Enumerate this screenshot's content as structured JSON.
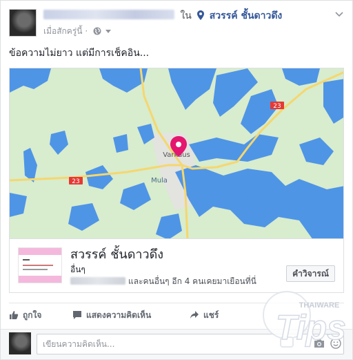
{
  "post": {
    "in_word": "ใน",
    "place_name": "สวรรค์ ชั้นดาวดึง",
    "timestamp": "เมื่อสักครู่นี้",
    "separator": "·",
    "text": "ข้อความไม่ยาว แต่มีการเช็คอิน..."
  },
  "map": {
    "city_label": "Varkaus",
    "town_label": "Mula",
    "road_label_west": "23",
    "road_label_east": "23"
  },
  "place_card": {
    "title": "สวรรค์ ชั้นดาวดึง",
    "category": "อื่นๆ",
    "visitors_text": "และคนอื่นๆ อีก 4 คนเคยมาเยือนที่นี่",
    "review_button": "คำวิจารณ์"
  },
  "actions": {
    "like": "ถูกใจ",
    "comment": "แสดงความคิดเห็น",
    "share": "แชร์"
  },
  "comment_box": {
    "placeholder": "เขียนความคิดเห็น..."
  },
  "watermark": {
    "brand_small": "THAIWARE",
    "brand_large": "Tips"
  },
  "colors": {
    "link": "#365899",
    "pin": "#e4166f",
    "water": "#4e94e6",
    "land": "#d9edce"
  }
}
